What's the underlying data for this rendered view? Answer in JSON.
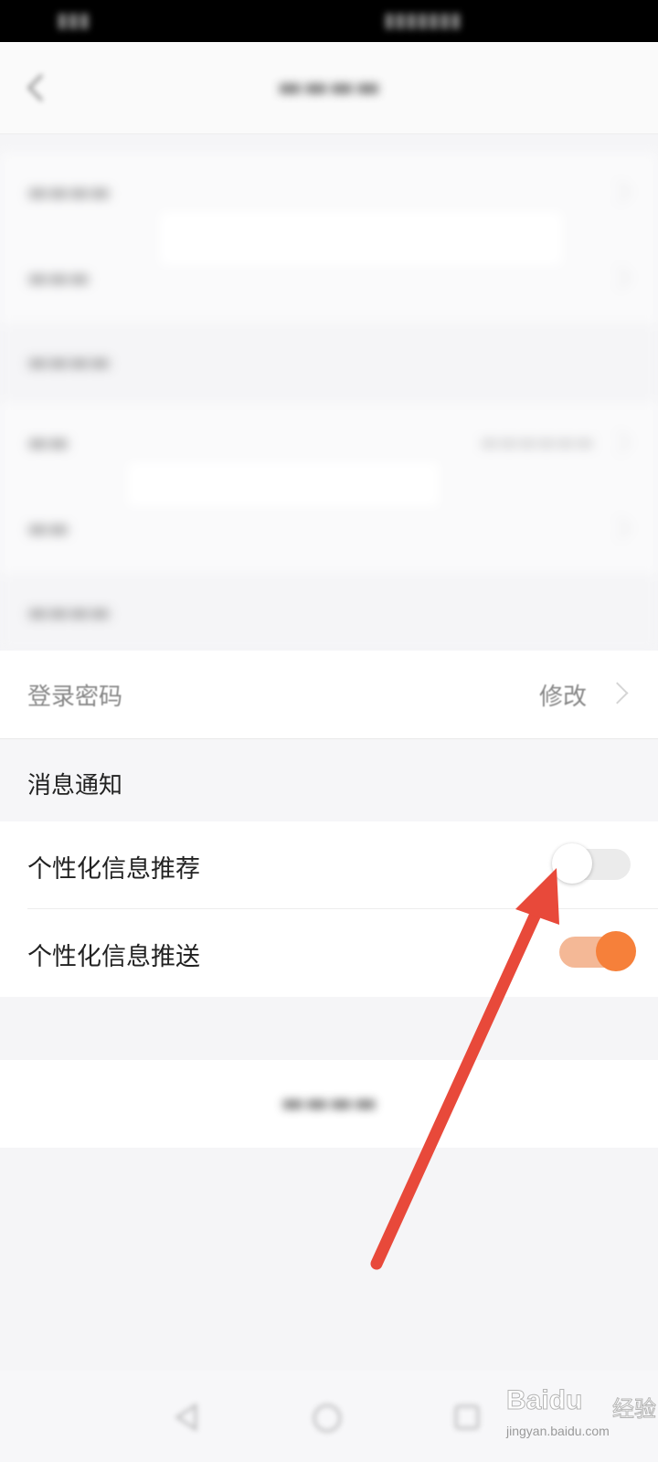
{
  "account_settings": {
    "password_row": {
      "label": "登录密码",
      "action": "修改"
    },
    "notification_section": {
      "header": "消息通知",
      "items": [
        {
          "label": "个性化信息推荐",
          "enabled": false
        },
        {
          "label": "个性化信息推送",
          "enabled": true
        }
      ]
    }
  },
  "colors": {
    "toggle_on_track": "#f4b896",
    "toggle_on_knob": "#f6803a",
    "toggle_off_track": "#ebebeb",
    "annotation_arrow": "#e8493a"
  },
  "watermark": {
    "brand": "Baidu",
    "sub": "经验",
    "url": "jingyan.baidu.com"
  }
}
